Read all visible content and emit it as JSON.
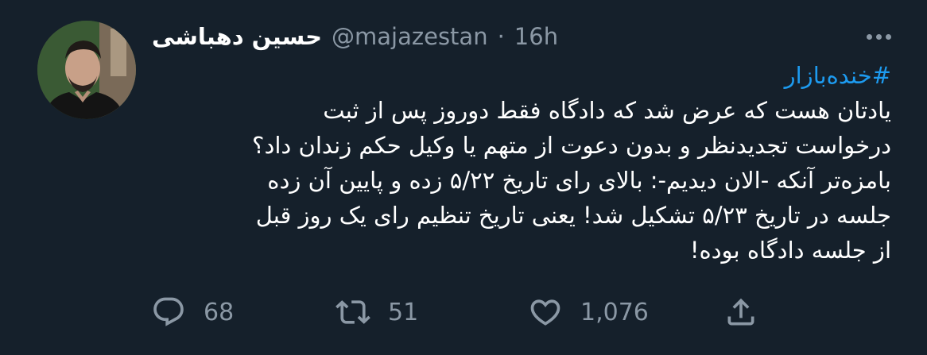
{
  "tweet": {
    "author_name": "حسین دهباشی",
    "handle": "@majazestan",
    "separator": "·",
    "time": "16h",
    "hashtag": "#خنده‌بازار",
    "lines": [
      "یادتان هست که عرض شد که دادگاه فقط دوروز پس از ثبت",
      "درخواست تجدیدنظر و بدون دعوت از متهم یا وکیل حکم زندان داد؟",
      "بامزه‌تر آنکه -الان دیدیم-: بالای رای تاریخ ۵/۲۲ زده و پایین آن زده",
      "جلسه در تاریخ ۵/۲۳ تشکیل شد! یعنی تاریخ تنظیم رای یک روز قبل",
      "از جلسه دادگاه بوده!"
    ],
    "reply_count": "68",
    "retweet_count": "51",
    "like_count": "1,076"
  },
  "icons": {
    "avatar": "profile-photo",
    "more": "more-horizontal-icon",
    "reply": "reply-bubble-icon",
    "retweet": "retweet-icon",
    "like": "heart-icon",
    "share": "share-upload-icon"
  },
  "colors": {
    "background": "#15202b",
    "text": "#ffffff",
    "secondary": "#8b98a5",
    "link": "#1d9bf0"
  }
}
